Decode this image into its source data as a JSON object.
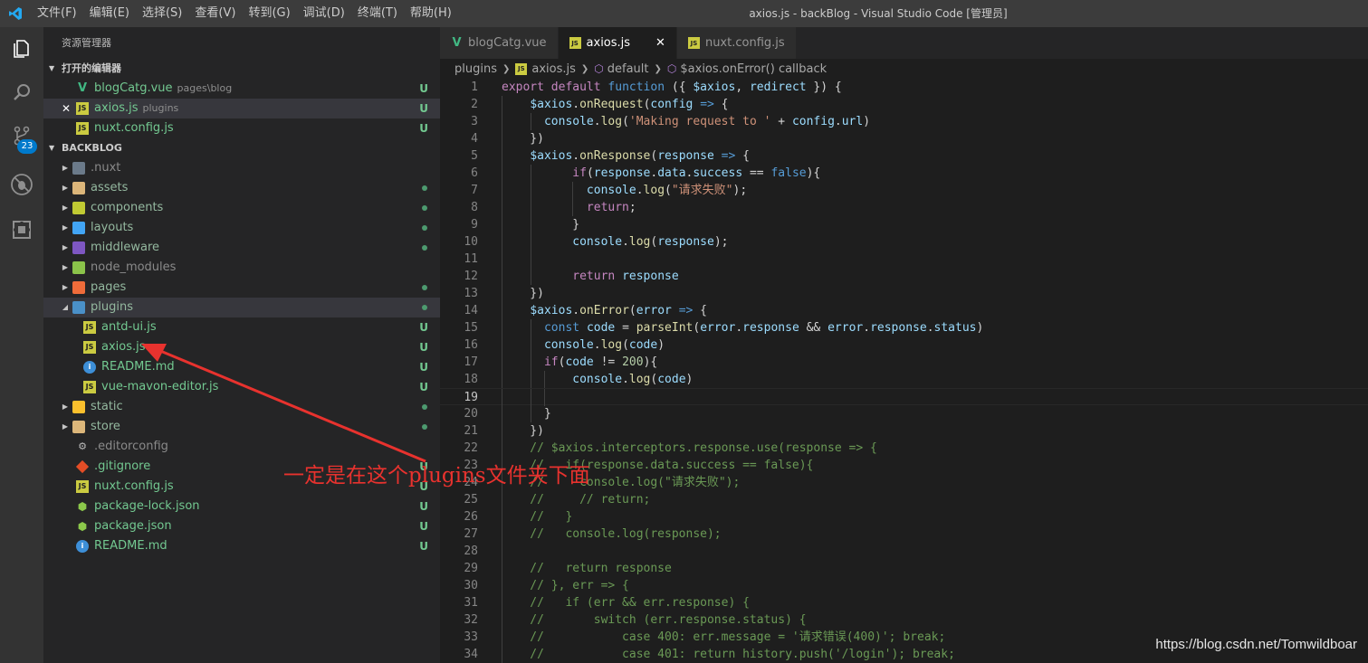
{
  "titlebar": {
    "menus": [
      "文件(F)",
      "编辑(E)",
      "选择(S)",
      "查看(V)",
      "转到(G)",
      "调试(D)",
      "终端(T)",
      "帮助(H)"
    ],
    "window_title": "axios.js - backBlog - Visual Studio Code [管理员]"
  },
  "activity_bar": {
    "scm_badge": "23"
  },
  "sidebar": {
    "title": "资源管理器",
    "open_editors_header": "打开的编辑器",
    "open_editors": [
      {
        "name": "blogCatg.vue",
        "desc": "pages\\blog",
        "status": "U",
        "icon": "vue-icon"
      },
      {
        "name": "axios.js",
        "desc": "plugins",
        "status": "U",
        "icon": "js-icon"
      },
      {
        "name": "nuxt.config.js",
        "desc": "",
        "status": "U",
        "icon": "js-icon"
      }
    ],
    "close_glyph": "✕",
    "project_header": "BACKBLOG",
    "tree": [
      {
        "name": ".nuxt"
      },
      {
        "name": "assets"
      },
      {
        "name": "components"
      },
      {
        "name": "layouts"
      },
      {
        "name": "middleware"
      },
      {
        "name": "node_modules"
      },
      {
        "name": "pages"
      },
      {
        "name": "plugins"
      },
      {
        "name": "antd-ui.js",
        "status": "U"
      },
      {
        "name": "axios.js",
        "status": "U"
      },
      {
        "name": "README.md",
        "status": "U"
      },
      {
        "name": "vue-mavon-editor.js",
        "status": "U"
      },
      {
        "name": "static"
      },
      {
        "name": "store"
      },
      {
        "name": ".editorconfig"
      },
      {
        "name": ".gitignore",
        "status": "U"
      },
      {
        "name": "nuxt.config.js",
        "status": "U"
      },
      {
        "name": "package-lock.json",
        "status": "U"
      },
      {
        "name": "package.json",
        "status": "U"
      },
      {
        "name": "README.md",
        "status": "U"
      }
    ]
  },
  "tabs": [
    {
      "label": "blogCatg.vue",
      "icon": "vue-icon"
    },
    {
      "label": "axios.js",
      "icon": "js-icon",
      "close": "✕"
    },
    {
      "label": "nuxt.config.js",
      "icon": "js-icon"
    }
  ],
  "breadcrumbs": {
    "folder": "plugins",
    "file": "axios.js",
    "symbol1": "default",
    "symbol2": "$axios.onError() callback"
  },
  "code": {
    "lines": [
      "1",
      "2",
      "3",
      "4",
      "5",
      "6",
      "7",
      "8",
      "9",
      "10",
      "11",
      "12",
      "13",
      "14",
      "15",
      "16",
      "17",
      "18",
      "19",
      "20",
      "21",
      "22",
      "23",
      "24",
      "25",
      "26",
      "27",
      "28",
      "29",
      "30",
      "31",
      "32",
      "33",
      "34"
    ]
  },
  "annotation": {
    "text": "一定是在这个plugins文件夹下面"
  },
  "watermark": "https://blog.csdn.net/Tomwildboar"
}
